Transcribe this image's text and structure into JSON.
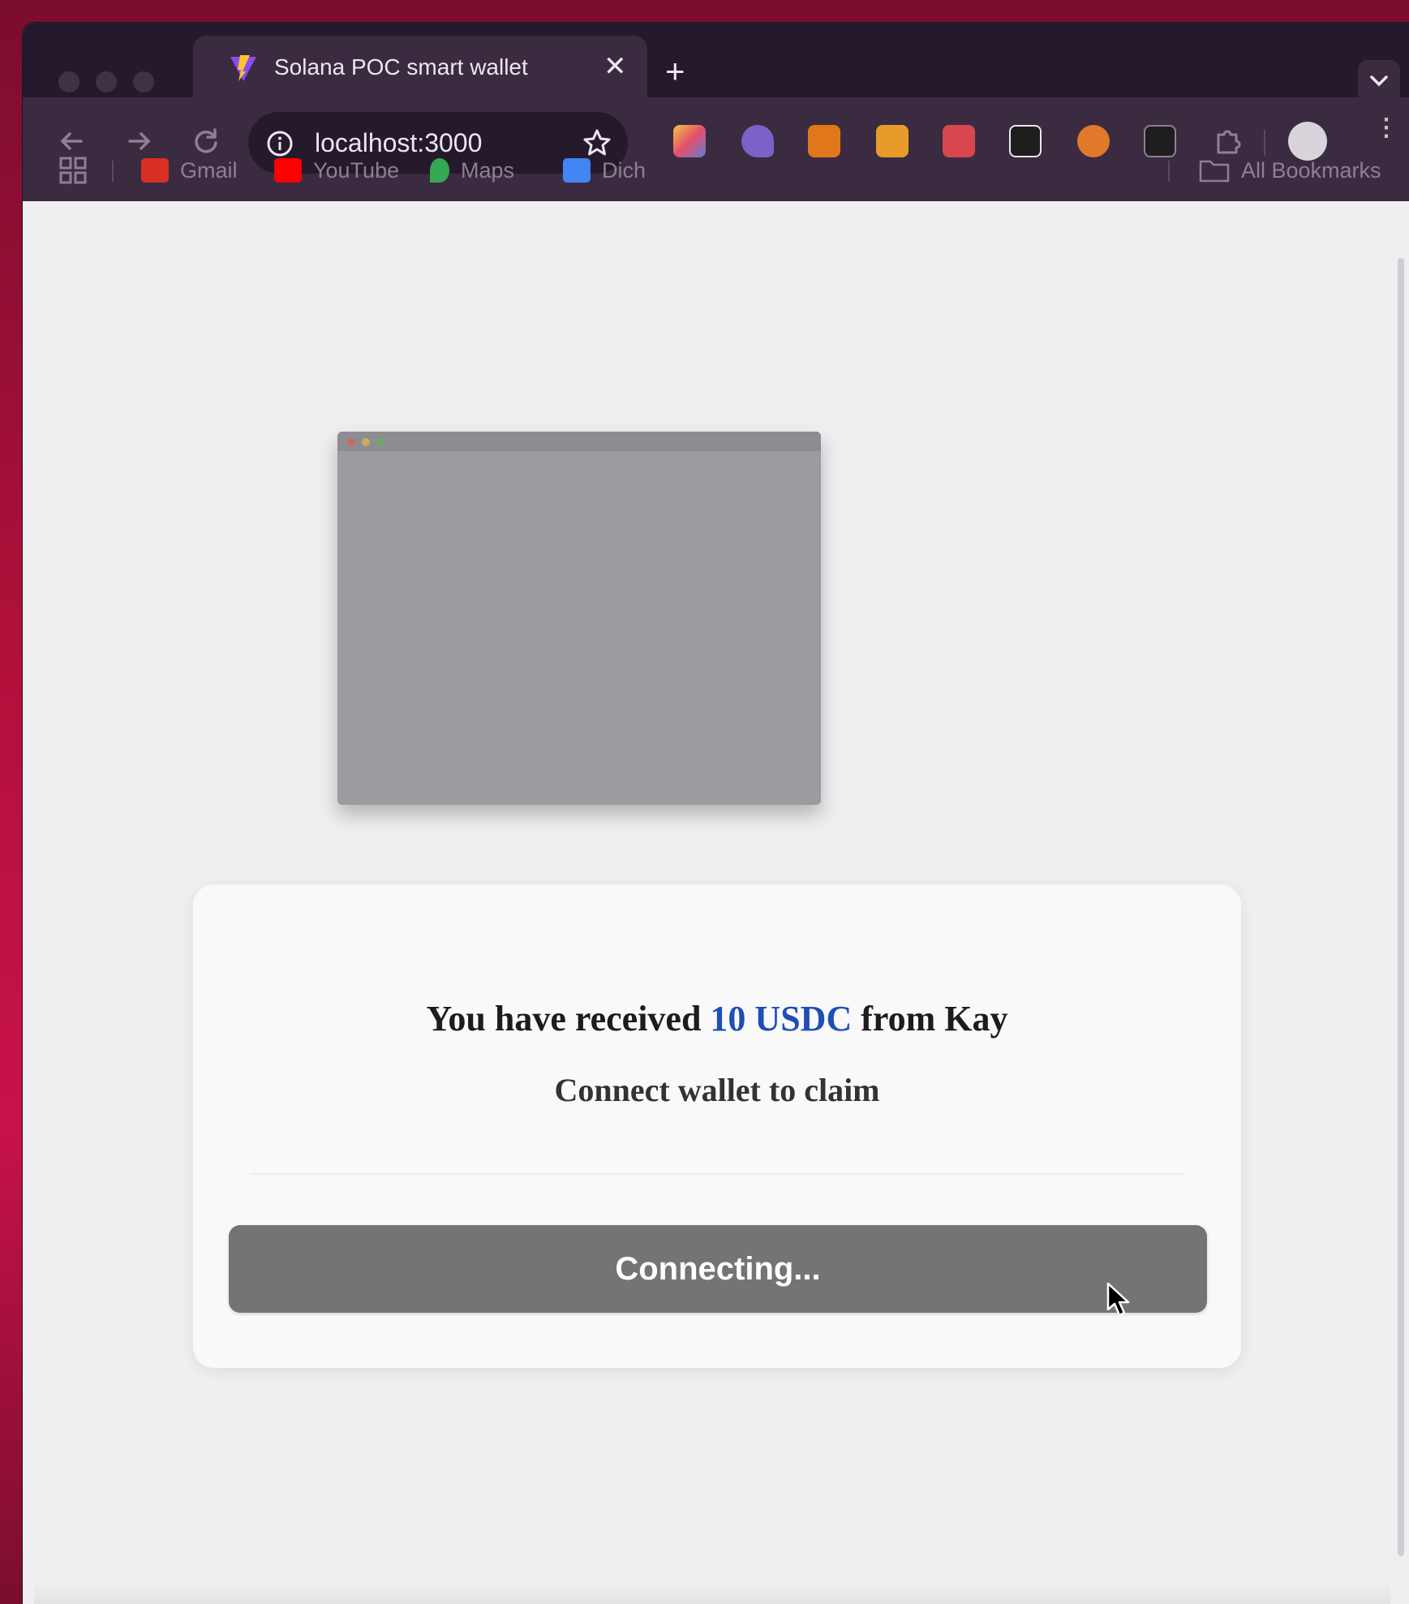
{
  "browser": {
    "tab": {
      "title": "Solana POC smart wallet",
      "close_glyph": "✕"
    },
    "new_tab_glyph": "+",
    "omnibox": {
      "url": "localhost:3000"
    },
    "bookmarks": [
      {
        "label": "Gmail",
        "color": "#d93025"
      },
      {
        "label": "YouTube",
        "color": "#ff0000"
      },
      {
        "label": "Maps",
        "color": "#34a853"
      },
      {
        "label": "Dich",
        "color": "#4285f4"
      }
    ],
    "all_bookmarks_label": "All Bookmarks",
    "extensions": [
      {
        "icon": "rainbow-extension-icon",
        "color": "#5b7fd6"
      },
      {
        "icon": "feather-extension-icon",
        "color": "#7b62c8"
      },
      {
        "icon": "fox-extension-icon",
        "color": "#e2761b"
      },
      {
        "icon": "square-extension-icon",
        "color": "#e89b2a"
      },
      {
        "icon": "p-extension-icon",
        "color": "#d8464e"
      },
      {
        "icon": "grid-extension-icon",
        "color": "#1e1e1e"
      },
      {
        "icon": "coin-extension-icon",
        "color": "#e07a2a"
      },
      {
        "icon": "s-extension-icon",
        "color": "#1e1e1e"
      },
      {
        "icon": "puzzle-icon",
        "color": "#c9bfce"
      }
    ]
  },
  "page": {
    "card": {
      "headline_prefix": "You have received",
      "headline_amount": "10 USDC",
      "headline_suffix": "from Kay",
      "subline": "Connect wallet to claim",
      "button_label": "Connecting..."
    },
    "colors": {
      "amount": "#1f4fb3",
      "button": "#747474"
    }
  }
}
